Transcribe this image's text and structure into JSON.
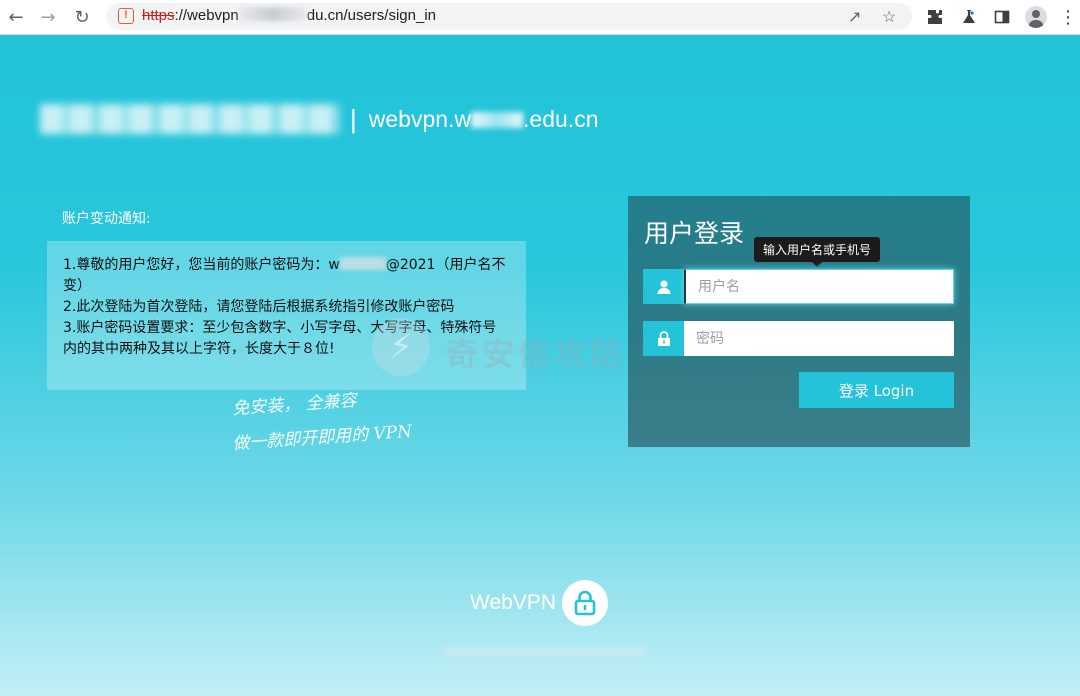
{
  "browser": {
    "url_protocol": "https",
    "url_host_start": "://webvpn",
    "url_rest": "du.cn/users/sign_in"
  },
  "brand": {
    "separator": "|",
    "domain_start": "webvpn.w",
    "domain_end": ".edu.cn"
  },
  "notice": {
    "title": "账户变动通知:",
    "line1_start": "1.尊敬的用户您好，您当前的账户密码为：w",
    "line1_end": "@2021（用户名不变）",
    "line2": "2.此次登陆为首次登陆，请您登陆后根据系统指引修改账户密码",
    "line3": "3.账户密码设置要求：至少包含数字、小写字母、大写字母、特殊符号内的其中两种及其以上字符，长度大于８位!"
  },
  "handwriting": {
    "line1": "免安装，  全兼容",
    "line2": "做一款即开即用的 VPN"
  },
  "watermark": {
    "text": "奇安信攻防社区"
  },
  "login": {
    "title": "用户登录",
    "tooltip": "输入用户名或手机号",
    "username_placeholder": "用户名",
    "password_placeholder": "密码",
    "submit_label": "登录 Login"
  },
  "footer": {
    "logo_text": "WebVPN"
  },
  "colors": {
    "accent": "#24c3d9",
    "panel": "#2b7d89"
  }
}
